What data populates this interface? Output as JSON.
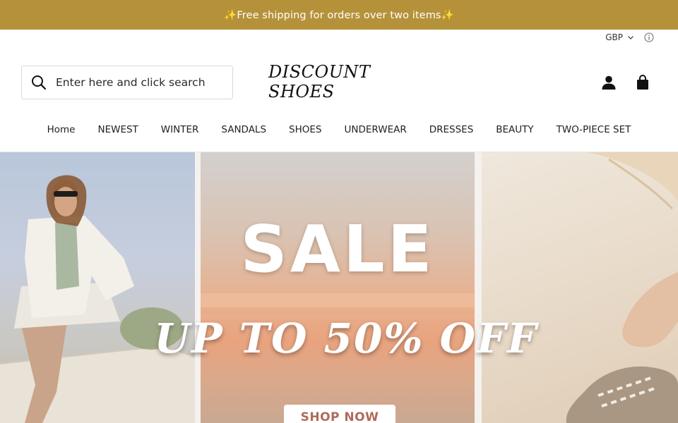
{
  "announcement": {
    "text": "✨Free shipping for orders over two items✨"
  },
  "currency": {
    "label": "GBP",
    "chevron_icon": "chevron-down-icon",
    "info_icon": "info-icon"
  },
  "search": {
    "placeholder": "Enter here and click search",
    "icon": "search-icon"
  },
  "logo": {
    "text": "DISCOUNT SHOES"
  },
  "header_icons": {
    "account": "account-icon",
    "cart": "shopping-bag-icon"
  },
  "nav": {
    "items": [
      {
        "label": "Home"
      },
      {
        "label": "NEWEST"
      },
      {
        "label": "WINTER"
      },
      {
        "label": "SANDALS"
      },
      {
        "label": "SHOES"
      },
      {
        "label": "UNDERWEAR"
      },
      {
        "label": "DRESSES"
      },
      {
        "label": "BEAUTY"
      },
      {
        "label": "TWO-PIECE SET"
      }
    ]
  },
  "hero": {
    "headline": "SALE",
    "subheadline": "UP TO 50% OFF",
    "cta_label": "SHOP NOW"
  },
  "colors": {
    "announcement_bg": "#b5923a",
    "cta_text": "#b06a5a"
  }
}
